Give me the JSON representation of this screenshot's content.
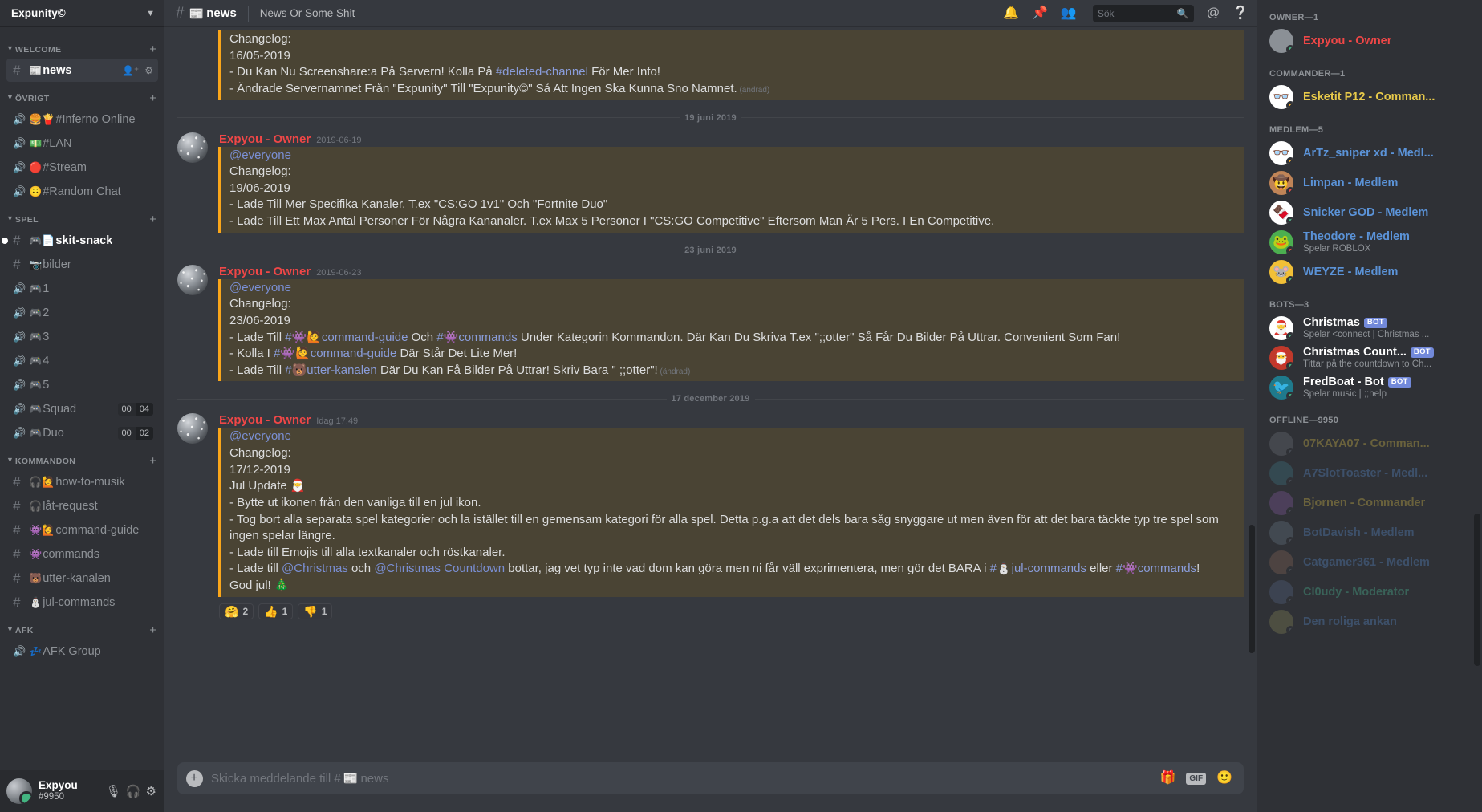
{
  "server": {
    "name": "Expunity©",
    "collapse_icon": "chevron-down"
  },
  "sidebar": {
    "categories": [
      {
        "name": "WELCOME",
        "channels": [
          {
            "type": "text",
            "emoji": "📰",
            "label": "news",
            "active": true,
            "icons": [
              "add-member",
              "settings"
            ]
          }
        ]
      },
      {
        "name": "ÖVRIGT",
        "channels": [
          {
            "type": "voice",
            "emoji": "🍔🍟",
            "label": "#Inferno Online"
          },
          {
            "type": "voice",
            "emoji": "💵",
            "label": "#LAN"
          },
          {
            "type": "voice-locked",
            "emoji": "🔴",
            "label": "#Stream"
          },
          {
            "type": "voice",
            "emoji": "🙃",
            "label": "#Random Chat"
          }
        ]
      },
      {
        "name": "SPEL",
        "channels": [
          {
            "type": "text",
            "emoji": "🎮📄",
            "label": "skit-snack",
            "unread": true
          },
          {
            "type": "text",
            "emoji": "📷",
            "label": "bilder"
          },
          {
            "type": "voice",
            "emoji": "🎮",
            "label": "1"
          },
          {
            "type": "voice",
            "emoji": "🎮",
            "label": "2"
          },
          {
            "type": "voice",
            "emoji": "🎮",
            "label": "3"
          },
          {
            "type": "voice",
            "emoji": "🎮",
            "label": "4"
          },
          {
            "type": "voice",
            "emoji": "🎮",
            "label": "5"
          },
          {
            "type": "voice",
            "emoji": "🎮",
            "label": "Squad",
            "count": "00",
            "limit": "04"
          },
          {
            "type": "voice",
            "emoji": "🎮",
            "label": "Duo",
            "count": "00",
            "limit": "02"
          }
        ]
      },
      {
        "name": "KOMMANDON",
        "channels": [
          {
            "type": "text",
            "emoji": "🎧🙋",
            "label": "how-to-musik"
          },
          {
            "type": "text",
            "emoji": "🎧",
            "label": "låt-request"
          },
          {
            "type": "text",
            "emoji": "👾🙋",
            "label": "command-guide"
          },
          {
            "type": "text",
            "emoji": "👾",
            "label": "commands"
          },
          {
            "type": "text",
            "emoji": "🐻",
            "label": "utter-kanalen"
          },
          {
            "type": "text",
            "emoji": "⛄",
            "label": "jul-commands"
          }
        ]
      },
      {
        "name": "AFK",
        "channels": [
          {
            "type": "voice",
            "emoji": "💤",
            "label": "AFK Group"
          }
        ]
      }
    ],
    "user_panel": {
      "name": "Expyou",
      "tag": "#9950",
      "icons": [
        "microphone-icon",
        "headphones-icon",
        "gear-icon"
      ]
    }
  },
  "topbar": {
    "hash": "#",
    "emoji": "📰",
    "channel": "news",
    "topic": "News Or Some Shit",
    "icons": [
      "bell-icon",
      "pin-icon",
      "members-icon",
      "mentions-icon",
      "help-icon"
    ],
    "search_placeholder": "Sök"
  },
  "messages": {
    "top_partial": {
      "lines": [
        {
          "text": "Changelog:"
        },
        {
          "text": "16/05-2019"
        },
        {
          "text": "- Du Kan Nu Screenshare:a På Servern! Kolla På #deleted-channel För Mer Info!"
        },
        {
          "text": "- Ändrade Servernamnet Från \"Expunity\" Till \"Expunity©\" Så Att Ingen Ska Kunna Sno Namnet.",
          "edited": "(ändrad)"
        }
      ]
    },
    "groups": [
      {
        "divider": "19 juni 2019",
        "author": "Expyou - Owner",
        "timestamp": "2019-06-19",
        "lines": [
          {
            "text": "@everyone",
            "kind": "everyone"
          },
          {
            "text": "Changelog:"
          },
          {
            "text": "19/06-2019"
          },
          {
            "text": "- Lade Till Mer Specifika Kanaler, T.ex \"CS:GO 1v1\" Och \"Fortnite Duo\""
          },
          {
            "text": "- Lade Till Ett Max Antal Personer För Några Kananaler. T.ex Max 5 Personer I \"CS:GO Competitive\" Eftersom Man Är 5 Pers. I En Competitive."
          }
        ]
      },
      {
        "divider": "23 juni 2019",
        "author": "Expyou - Owner",
        "timestamp": "2019-06-23",
        "lines": [
          {
            "text": "@everyone",
            "kind": "everyone"
          },
          {
            "text": "Changelog:"
          },
          {
            "text": "23/06-2019"
          },
          {
            "text": "- Lade Till #👾🙋command-guide Och #👾commands Under Kategorin Kommandon. Där Kan Du Skriva T.ex \";;otter\" Så Får Du Bilder På Uttrar. Convenient Som Fan!"
          },
          {
            "text": "- Kolla I #👾🙋command-guide Där Står Det Lite Mer!"
          },
          {
            "text": "- Lade Till #🐻utter-kanalen Där Du Kan Få Bilder På Uttrar! Skriv Bara \" ;;otter\"!",
            "edited": "(ändrad)"
          }
        ]
      },
      {
        "divider": "17 december 2019",
        "author": "Expyou - Owner",
        "timestamp": "Idag 17:49",
        "lines": [
          {
            "text": "@everyone",
            "kind": "everyone"
          },
          {
            "text": "Changelog:"
          },
          {
            "text": "17/12-2019"
          },
          {
            "text": "Jul Update 🎅"
          },
          {
            "text": "- Bytte ut ikonen från den vanliga till en jul ikon."
          },
          {
            "text": "- Tog bort alla separata spel kategorier och la istället till en gemensam kategori för alla spel. Detta p.g.a att det dels bara såg snyggare ut men även för att det bara täckte typ tre spel som ingen spelar längre."
          },
          {
            "text": "- Lade till Emojis till alla textkanaler och röstkanaler."
          },
          {
            "text": "- Lade till @Christmas och @Christmas Countdown bottar, jag vet typ inte vad dom kan göra men ni får väll exprimentera, men gör det BARA i #⛄jul-commands eller #👾commands!"
          },
          {
            "text": "God jul! 🎄"
          }
        ],
        "reactions": [
          {
            "emoji": "🤗",
            "count": "2"
          },
          {
            "emoji": "👍",
            "count": "1"
          },
          {
            "emoji": "👎",
            "count": "1"
          }
        ]
      }
    ]
  },
  "composer": {
    "placeholder_prefix": "Skicka meddelande till #",
    "placeholder_emoji": "📰",
    "placeholder_channel": "news",
    "gift_icon": "gift-icon",
    "gif_label": "GIF",
    "emoji_icon": "emoji-icon"
  },
  "member_list": {
    "groups": [
      {
        "title": "OWNER—1",
        "members": [
          {
            "name": "Expyou - Owner",
            "color": "#f04747",
            "status": "online",
            "avatar_bg": "#8b9096",
            "avatar_glyph": ""
          }
        ]
      },
      {
        "title": "COMMANDER—1",
        "members": [
          {
            "name": "Esketit P12 - Comman...",
            "color": "#e7c94a",
            "status": "idle",
            "avatar_bg": "#ffffff",
            "avatar_glyph": "👓"
          }
        ]
      },
      {
        "title": "MEDLEM—5",
        "members": [
          {
            "name": "ArTz_sniper xd - Medl...",
            "color": "#5b93d8",
            "status": "idle",
            "avatar_bg": "#ffffff",
            "avatar_glyph": "👓"
          },
          {
            "name": "Limpan - Medlem",
            "color": "#5b93d8",
            "status": "dnd",
            "avatar_bg": "#c08457",
            "avatar_glyph": "🤠"
          },
          {
            "name": "Snicker GOD - Medlem",
            "color": "#5b93d8",
            "status": "online",
            "avatar_bg": "#ffffff",
            "avatar_glyph": "🍫"
          },
          {
            "name": "Theodore - Medlem",
            "sub": "Spelar ROBLOX",
            "color": "#5b93d8",
            "status": "dnd",
            "avatar_bg": "#4caf50",
            "avatar_glyph": "🐸"
          },
          {
            "name": "WEYZE - Medlem",
            "color": "#5b93d8",
            "status": "online",
            "avatar_bg": "#f2c037",
            "avatar_glyph": "🐭"
          }
        ]
      },
      {
        "title": "BOTS—3",
        "members": [
          {
            "name": "Christmas",
            "bot": "BOT",
            "sub": "Spelar <connect | Christmas ...",
            "color": "#ffffff",
            "status": "online",
            "avatar_bg": "#ffffff",
            "avatar_glyph": "🎅"
          },
          {
            "name": "Christmas Count...",
            "bot": "BOT",
            "sub": "Tittar på the countdown to Ch...",
            "color": "#ffffff",
            "status": "online",
            "avatar_bg": "#c0392b",
            "avatar_glyph": "🎅"
          },
          {
            "name": "FredBoat - Bot",
            "bot": "BOT",
            "sub": "Spelar music | ;;help",
            "color": "#ffffff",
            "status": "online",
            "avatar_bg": "#1f7a8c",
            "avatar_glyph": "🐦"
          }
        ]
      },
      {
        "title": "OFFLINE—9950",
        "offline": true,
        "members": [
          {
            "name": "07KAYA07 - Comman...",
            "color": "#e7c94a",
            "status": "offline",
            "avatar_bg": "#72767d",
            "avatar_glyph": ""
          },
          {
            "name": "A7SlotToaster - Medl...",
            "color": "#5b93d8",
            "status": "offline",
            "avatar_bg": "#3f7d8c",
            "avatar_glyph": ""
          },
          {
            "name": "Bjornen - Commander",
            "color": "#e7c94a",
            "status": "offline",
            "avatar_bg": "#8b5fa8",
            "avatar_glyph": ""
          },
          {
            "name": "BotDavish - Medlem",
            "color": "#5b93d8",
            "status": "offline",
            "avatar_bg": "#6b7d8c",
            "avatar_glyph": ""
          },
          {
            "name": "Catgamer361 - Medlem",
            "color": "#5b93d8",
            "status": "offline",
            "avatar_bg": "#8c6b5a",
            "avatar_glyph": ""
          },
          {
            "name": "Cl0udy - Moderator",
            "color": "#4ec9a0",
            "status": "offline",
            "avatar_bg": "#5a6b8c",
            "avatar_glyph": ""
          },
          {
            "name": "Den roliga ankan",
            "color": "#5b93d8",
            "status": "offline",
            "avatar_bg": "#8c8c5a",
            "avatar_glyph": ""
          }
        ]
      }
    ]
  }
}
